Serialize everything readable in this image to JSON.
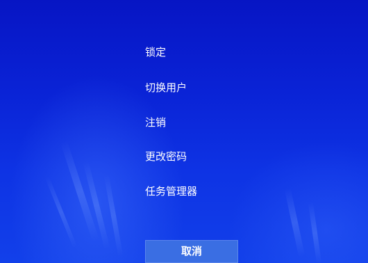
{
  "menu": {
    "items": [
      {
        "label": "锁定"
      },
      {
        "label": "切换用户"
      },
      {
        "label": "注销"
      },
      {
        "label": "更改密码"
      },
      {
        "label": "任务管理器"
      }
    ]
  },
  "cancel": {
    "label": "取消"
  },
  "colors": {
    "background": "#0a23d6",
    "button": "#3a6ee3",
    "text": "#ffffff"
  }
}
